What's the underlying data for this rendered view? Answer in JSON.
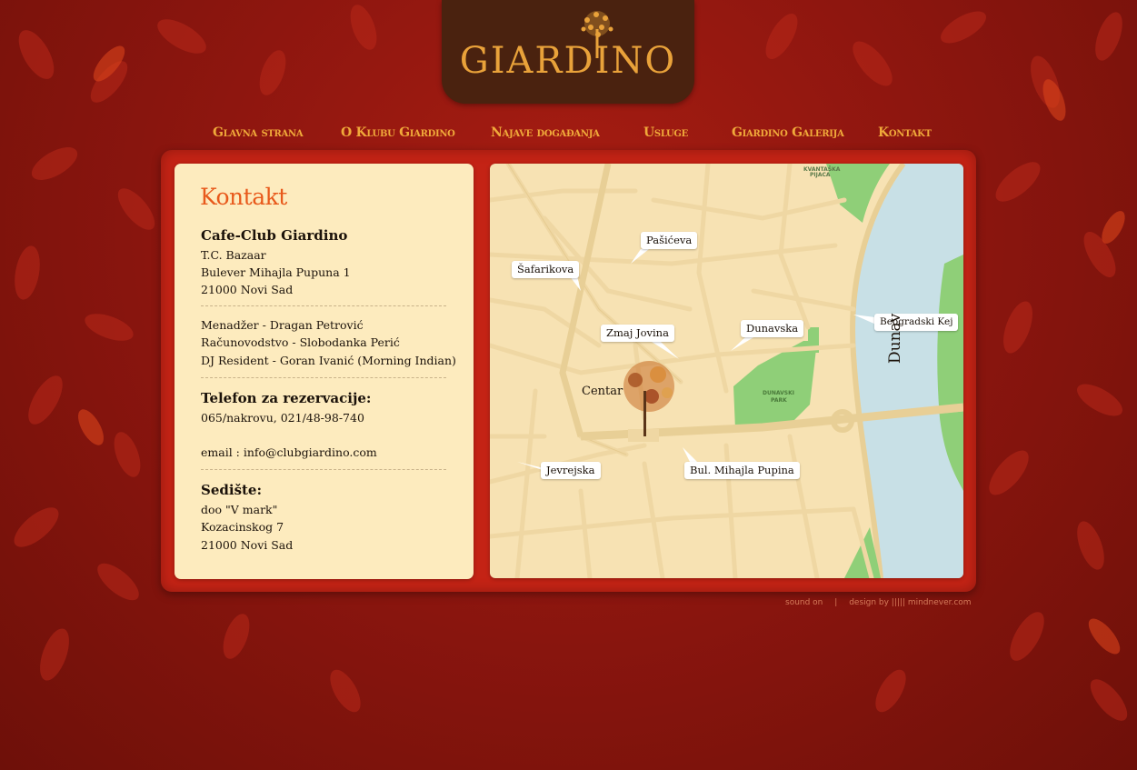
{
  "logo": {
    "text": "GIARDINO"
  },
  "nav": [
    {
      "label": "Glavna strana"
    },
    {
      "label": "O Klubu Giardino"
    },
    {
      "label": "Najave događanja"
    },
    {
      "label": "Usluge"
    },
    {
      "label": "Giardino Galerija"
    },
    {
      "label": "Kontakt"
    }
  ],
  "info": {
    "title": "Kontakt",
    "club_name": "Cafe-Club Giardino",
    "address_lines": [
      "T.C. Bazaar",
      "Bulever Mihajla Pupuna 1",
      "21000 Novi Sad"
    ],
    "staff_lines": [
      "Menadžer - Dragan Petrović",
      "Računovodstvo - Slobodanka Perić",
      "DJ Resident - Goran Ivanić (Morning Indian)"
    ],
    "phone_heading": "Telefon za rezervacije:",
    "phone": "065/nakrovu,  021/48-98-740",
    "email": "email : info@clubgiardino.com",
    "seat_heading": "Sedište:",
    "seat_lines": [
      "doo \"V mark\"",
      "Kozacinskog 7",
      "21000 Novi Sad"
    ]
  },
  "map": {
    "bubbles": [
      "Pašićeva",
      "Šafarikova",
      "Zmaj Jovina",
      "Dunavska",
      "Beogradski Kej",
      "Jevrejska",
      "Bul. Mihajla Pupina"
    ],
    "center_label": "Centar",
    "river_label": "Dunav",
    "park_label": "DUNAVSKI PARK",
    "market_label": "KVANTAŠKA PIJACA",
    "colors": {
      "background": "#f7e2b3",
      "park": "#8fcf78",
      "river": "#c8e0e6",
      "street": "#efd7a3"
    }
  },
  "footer": {
    "sound": "sound on",
    "divider": "|",
    "design": "design by ||||| mindnever.com"
  }
}
